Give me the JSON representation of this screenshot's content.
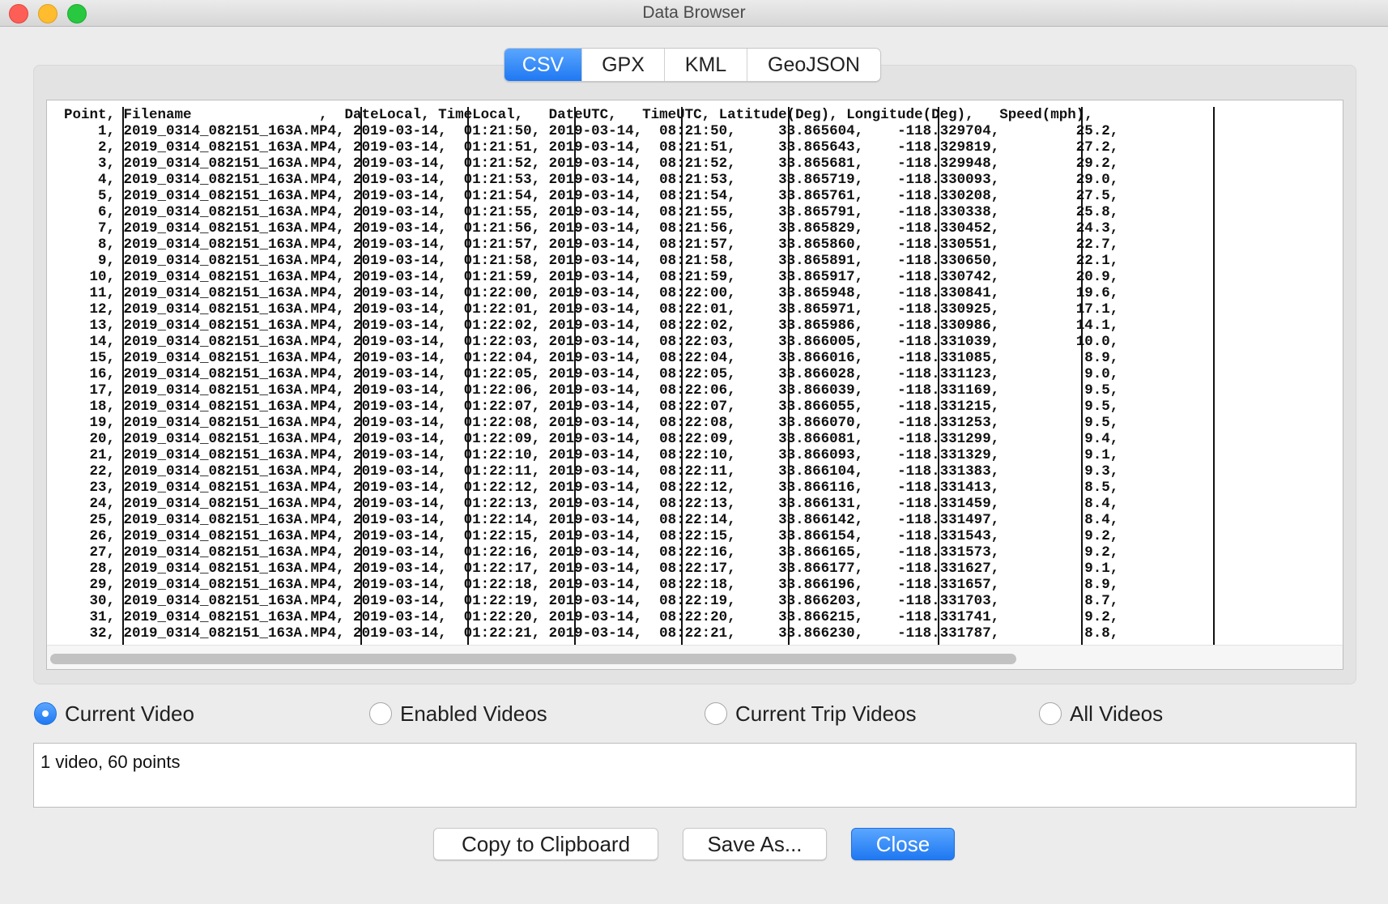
{
  "window": {
    "title": "Data Browser"
  },
  "tabs": [
    {
      "label": "CSV",
      "active": true
    },
    {
      "label": "GPX",
      "active": false
    },
    {
      "label": "KML",
      "active": false
    },
    {
      "label": "GeoJSON",
      "active": false
    }
  ],
  "csv": {
    "header": "  Point, Filename               ,  DateLocal, TimeLocal,   DateUTC,   TimeUTC, Latitude(Deg), Longitude(Deg),   Speed(mph),",
    "rows": [
      "      1, 2019_0314_082151_163A.MP4, 2019-03-14,  01:21:50, 2019-03-14,  08:21:50,     33.865604,    -118.329704,         25.2,",
      "      2, 2019_0314_082151_163A.MP4, 2019-03-14,  01:21:51, 2019-03-14,  08:21:51,     33.865643,    -118.329819,         27.2,",
      "      3, 2019_0314_082151_163A.MP4, 2019-03-14,  01:21:52, 2019-03-14,  08:21:52,     33.865681,    -118.329948,         29.2,",
      "      4, 2019_0314_082151_163A.MP4, 2019-03-14,  01:21:53, 2019-03-14,  08:21:53,     33.865719,    -118.330093,         29.0,",
      "      5, 2019_0314_082151_163A.MP4, 2019-03-14,  01:21:54, 2019-03-14,  08:21:54,     33.865761,    -118.330208,         27.5,",
      "      6, 2019_0314_082151_163A.MP4, 2019-03-14,  01:21:55, 2019-03-14,  08:21:55,     33.865791,    -118.330338,         25.8,",
      "      7, 2019_0314_082151_163A.MP4, 2019-03-14,  01:21:56, 2019-03-14,  08:21:56,     33.865829,    -118.330452,         24.3,",
      "      8, 2019_0314_082151_163A.MP4, 2019-03-14,  01:21:57, 2019-03-14,  08:21:57,     33.865860,    -118.330551,         22.7,",
      "      9, 2019_0314_082151_163A.MP4, 2019-03-14,  01:21:58, 2019-03-14,  08:21:58,     33.865891,    -118.330650,         22.1,",
      "     10, 2019_0314_082151_163A.MP4, 2019-03-14,  01:21:59, 2019-03-14,  08:21:59,     33.865917,    -118.330742,         20.9,",
      "     11, 2019_0314_082151_163A.MP4, 2019-03-14,  01:22:00, 2019-03-14,  08:22:00,     33.865948,    -118.330841,         19.6,",
      "     12, 2019_0314_082151_163A.MP4, 2019-03-14,  01:22:01, 2019-03-14,  08:22:01,     33.865971,    -118.330925,         17.1,",
      "     13, 2019_0314_082151_163A.MP4, 2019-03-14,  01:22:02, 2019-03-14,  08:22:02,     33.865986,    -118.330986,         14.1,",
      "     14, 2019_0314_082151_163A.MP4, 2019-03-14,  01:22:03, 2019-03-14,  08:22:03,     33.866005,    -118.331039,         10.0,",
      "     15, 2019_0314_082151_163A.MP4, 2019-03-14,  01:22:04, 2019-03-14,  08:22:04,     33.866016,    -118.331085,          8.9,",
      "     16, 2019_0314_082151_163A.MP4, 2019-03-14,  01:22:05, 2019-03-14,  08:22:05,     33.866028,    -118.331123,          9.0,",
      "     17, 2019_0314_082151_163A.MP4, 2019-03-14,  01:22:06, 2019-03-14,  08:22:06,     33.866039,    -118.331169,          9.5,",
      "     18, 2019_0314_082151_163A.MP4, 2019-03-14,  01:22:07, 2019-03-14,  08:22:07,     33.866055,    -118.331215,          9.5,",
      "     19, 2019_0314_082151_163A.MP4, 2019-03-14,  01:22:08, 2019-03-14,  08:22:08,     33.866070,    -118.331253,          9.5,",
      "     20, 2019_0314_082151_163A.MP4, 2019-03-14,  01:22:09, 2019-03-14,  08:22:09,     33.866081,    -118.331299,          9.4,",
      "     21, 2019_0314_082151_163A.MP4, 2019-03-14,  01:22:10, 2019-03-14,  08:22:10,     33.866093,    -118.331329,          9.1,",
      "     22, 2019_0314_082151_163A.MP4, 2019-03-14,  01:22:11, 2019-03-14,  08:22:11,     33.866104,    -118.331383,          9.3,",
      "     23, 2019_0314_082151_163A.MP4, 2019-03-14,  01:22:12, 2019-03-14,  08:22:12,     33.866116,    -118.331413,          8.5,",
      "     24, 2019_0314_082151_163A.MP4, 2019-03-14,  01:22:13, 2019-03-14,  08:22:13,     33.866131,    -118.331459,          8.4,",
      "     25, 2019_0314_082151_163A.MP4, 2019-03-14,  01:22:14, 2019-03-14,  08:22:14,     33.866142,    -118.331497,          8.4,",
      "     26, 2019_0314_082151_163A.MP4, 2019-03-14,  01:22:15, 2019-03-14,  08:22:15,     33.866154,    -118.331543,          9.2,",
      "     27, 2019_0314_082151_163A.MP4, 2019-03-14,  01:22:16, 2019-03-14,  08:22:16,     33.866165,    -118.331573,          9.2,",
      "     28, 2019_0314_082151_163A.MP4, 2019-03-14,  01:22:17, 2019-03-14,  08:22:17,     33.866177,    -118.331627,          9.1,",
      "     29, 2019_0314_082151_163A.MP4, 2019-03-14,  01:22:18, 2019-03-14,  08:22:18,     33.866196,    -118.331657,          8.9,",
      "     30, 2019_0314_082151_163A.MP4, 2019-03-14,  01:22:19, 2019-03-14,  08:22:19,     33.866203,    -118.331703,          8.7,",
      "     31, 2019_0314_082151_163A.MP4, 2019-03-14,  01:22:20, 2019-03-14,  08:22:20,     33.866215,    -118.331741,          9.2,",
      "     32, 2019_0314_082151_163A.MP4, 2019-03-14,  01:22:21, 2019-03-14,  08:22:21,     33.866230,    -118.331787,          8.8,"
    ]
  },
  "scope": {
    "options": [
      {
        "label": "Current Video",
        "checked": true
      },
      {
        "label": "Enabled Videos",
        "checked": false
      },
      {
        "label": "Current Trip Videos",
        "checked": false
      },
      {
        "label": "All Videos",
        "checked": false
      }
    ]
  },
  "status": {
    "text": "1 video, 60 points"
  },
  "buttons": {
    "copy": "Copy to Clipboard",
    "save": "Save As...",
    "close": "Close"
  },
  "colors": {
    "accent": "#2b86f9",
    "close_red": "#fd5f57",
    "minimize_yellow": "#febc2e",
    "zoom_green": "#28c840"
  }
}
